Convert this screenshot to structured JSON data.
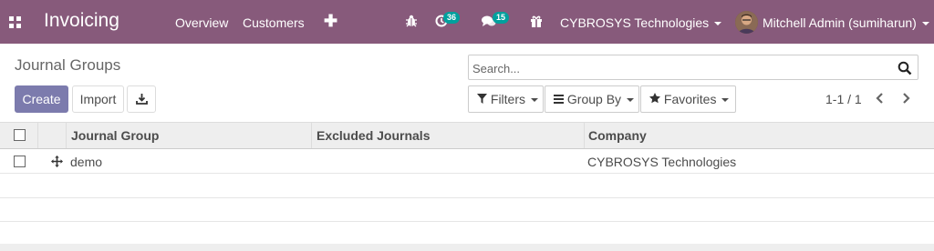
{
  "navbar": {
    "app_name": "Invoicing",
    "menu": [
      "Overview",
      "Customers"
    ],
    "plus_label": "✚",
    "activity_badge": "36",
    "messages_badge": "15",
    "company": "CYBROSYS Technologies",
    "user": "Mitchell Admin (sumiharun)"
  },
  "control_panel": {
    "title": "Journal Groups",
    "create_label": "Create",
    "import_label": "Import",
    "search_placeholder": "Search...",
    "filters_label": "Filters",
    "groupby_label": "Group By",
    "favorites_label": "Favorites",
    "pager": "1-1 / 1"
  },
  "table": {
    "columns": [
      "Journal Group",
      "Excluded Journals",
      "Company"
    ],
    "rows": [
      {
        "journal_group": "demo",
        "excluded_journals": "",
        "company": "CYBROSYS Technologies"
      }
    ]
  },
  "colors": {
    "navbar": "#875a7b",
    "primary": "#7c7bad",
    "badge": "#00a09d"
  }
}
